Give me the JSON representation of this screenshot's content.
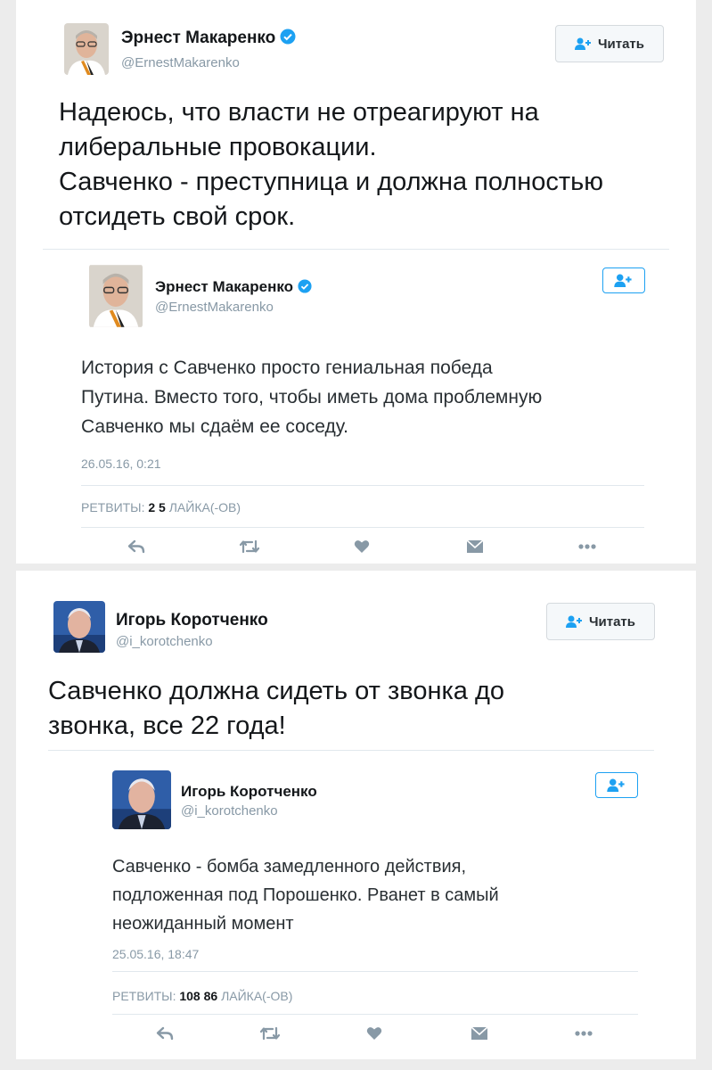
{
  "tweets": [
    {
      "author": {
        "name": "Эрнест Макаренко",
        "handle": "@ErnestMakarenko",
        "verified": true
      },
      "follow_label": "Читать",
      "text": "Надеюсь, что власти не отреагируют на\nлиберальные провокации.\nСавченко - преступница и должна полностью\nотсидеть свой срок.",
      "quoted": {
        "author": {
          "name": "Эрнест Макаренко",
          "handle": "@ErnestMakarenko",
          "verified": true
        },
        "text": "История с Савченко просто гениальная победа\nПутина. Вместо того, чтобы иметь дома проблемную\nСавченко мы сдаём ее соседу.",
        "timestamp": "26.05.16, 0:21",
        "retweets_label": "РЕТВИТЫ:",
        "retweets": "2",
        "likes": "5",
        "likes_label": "ЛАЙКА(-ОВ)"
      }
    },
    {
      "author": {
        "name": "Игорь Коротченко",
        "handle": "@i_korotchenko",
        "verified": false
      },
      "follow_label": "Читать",
      "text": "Савченко должна сидеть от звонка до\nзвонка, все 22 года!",
      "quoted": {
        "author": {
          "name": "Игорь Коротченко",
          "handle": "@i_korotchenko",
          "verified": false
        },
        "text": "Савченко - бомба замедленного действия,\nподложенная под Порошенко. Рванет в самый\nнеожиданный момент",
        "timestamp": "25.05.16, 18:47",
        "retweets_label": "РЕТВИТЫ:",
        "retweets": "108",
        "likes": "86",
        "likes_label": "ЛАЙКА(-ОВ)"
      }
    }
  ],
  "icons": {
    "reply": "reply-icon",
    "retweet": "retweet-icon",
    "like": "heart-icon",
    "dm": "message-icon",
    "more": "more-icon",
    "follow": "follow-person-icon",
    "verified": "verified-badge-icon"
  },
  "colors": {
    "accent": "#1da1f2",
    "muted": "#8899a6",
    "text": "#14171a",
    "divider": "#e1e8ed"
  }
}
